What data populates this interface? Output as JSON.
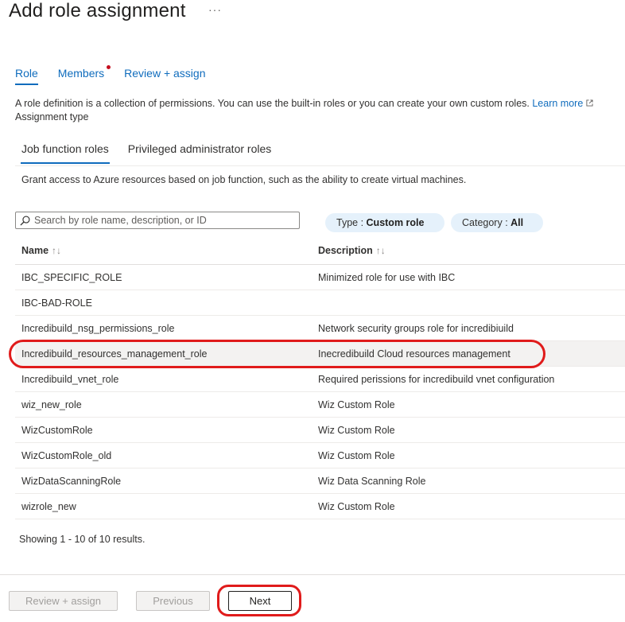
{
  "page": {
    "title": "Add role assignment",
    "more_label": "···"
  },
  "tabs": [
    {
      "label": "Role",
      "active": true
    },
    {
      "label": "Members",
      "active": false,
      "has_dot": true
    },
    {
      "label": "Review + assign",
      "active": false
    }
  ],
  "description": {
    "text": "A role definition is a collection of permissions. You can use the built-in roles or you can create your own custom roles.",
    "learn_more": "Learn more",
    "assignment_type": "Assignment type"
  },
  "subtabs": [
    {
      "label": "Job function roles",
      "active": true
    },
    {
      "label": "Privileged administrator roles",
      "active": false
    }
  ],
  "grant_text": "Grant access to Azure resources based on job function, such as the ability to create virtual machines.",
  "search": {
    "placeholder": "Search by role name, description, or ID",
    "value": ""
  },
  "filters": {
    "type_label": "Type : ",
    "type_value": "Custom role",
    "category_label": "Category : ",
    "category_value": "All"
  },
  "table": {
    "headers": {
      "name": "Name",
      "description": "Description",
      "sort_icon": "↑↓"
    },
    "rows": [
      {
        "name": "IBC_SPECIFIC_ROLE",
        "description": "Minimized role for use with IBC"
      },
      {
        "name": "IBC-BAD-ROLE",
        "description": ""
      },
      {
        "name": "Incredibuild_nsg_permissions_role",
        "description": "Network security groups role for incredibiuild"
      },
      {
        "name": "Incredibuild_resources_management_role",
        "description": "Inecredibuild Cloud resources management"
      },
      {
        "name": "Incredibuild_vnet_role",
        "description": "Required perissions for incredibuild vnet configuration"
      },
      {
        "name": "wiz_new_role",
        "description": "Wiz Custom Role"
      },
      {
        "name": "WizCustomRole",
        "description": "Wiz Custom Role"
      },
      {
        "name": "WizCustomRole_old",
        "description": "Wiz Custom Role"
      },
      {
        "name": "WizDataScanningRole",
        "description": "Wiz Data Scanning Role"
      },
      {
        "name": "wizrole_new",
        "description": "Wiz Custom Role"
      }
    ],
    "showing": "Showing 1 - 10 of 10 results."
  },
  "footer": {
    "review_assign": "Review + assign",
    "previous": "Previous",
    "next": "Next"
  },
  "colors": {
    "accent": "#0f6cbd",
    "highlight": "#e01b1b"
  }
}
